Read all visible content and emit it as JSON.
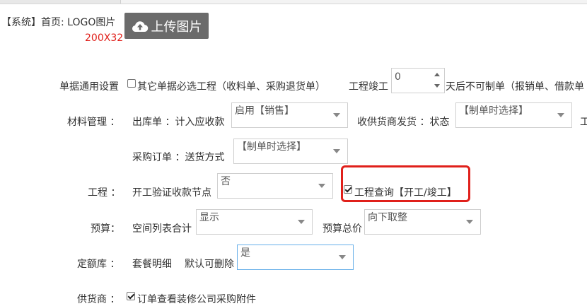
{
  "header": {
    "breadcrumb": "【系统】首页: LOGO图片",
    "upload_label": "上传图片",
    "size_hint": "200X32"
  },
  "row1": {
    "label": "单据通用设置",
    "cb_label": "其它单据必选工程（收料单、采购退货单）",
    "cb_checked": false,
    "completion_label": "工程竣工",
    "completion_days": "0",
    "after_text": "天后不可制单（报销单、借款单"
  },
  "row2": {
    "label": "材料管理 ：",
    "outbound_label": "出库单 ：计入应收款",
    "outbound_value": "启用【销售】",
    "supplier_label": "收供货商发货 ：状态",
    "supplier_value": "【制单时选择】",
    "cut_text": "工"
  },
  "row3": {
    "purchase_label": "采购订单 ：送货方式",
    "purchase_value": "【制单时选择】"
  },
  "row4": {
    "label": "工程 ：",
    "verify_label": "开工验证收款节点",
    "verify_value": "否",
    "query_label": "工程查询【开工/竣工】",
    "query_checked": true
  },
  "row5": {
    "label": "预算：",
    "space_label": "空间列表合计",
    "space_value": "显示",
    "total_label": "预算总价",
    "total_value": "向下取整"
  },
  "row6": {
    "label": "定额库 ：",
    "package_label": "套餐明细",
    "deletable_label": "默认可删除",
    "deletable_value": "是"
  },
  "row7": {
    "label": "供货商 ：",
    "cb_label": "订单查看装修公司采购附件",
    "cb_checked": true
  },
  "colors": {
    "accent_red": "#e0201b",
    "button_gray": "#6b6b6b",
    "focus_border": "#66afe9"
  },
  "icons": {
    "upload": "cloud-upload-icon",
    "dropdown": "chevron-down-icon"
  }
}
